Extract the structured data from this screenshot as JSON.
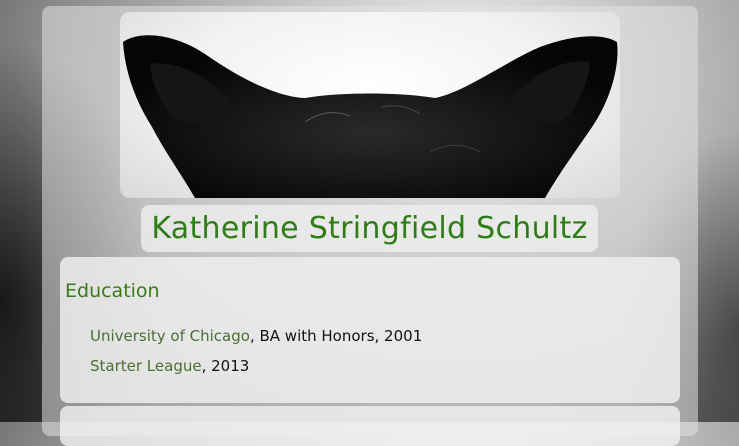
{
  "profile": {
    "name": "Katherine Stringfield Schultz",
    "photo_icon": "dog-ears-photo"
  },
  "education": {
    "heading": "Education",
    "items": [
      {
        "school": "University of Chicago",
        "detail": ", BA with Honors, 2001"
      },
      {
        "school": "Starter League",
        "detail": ", 2013"
      }
    ]
  },
  "colors": {
    "name": "#2f7d16",
    "heading": "#3a7a1a",
    "link": "#4c6e33"
  }
}
